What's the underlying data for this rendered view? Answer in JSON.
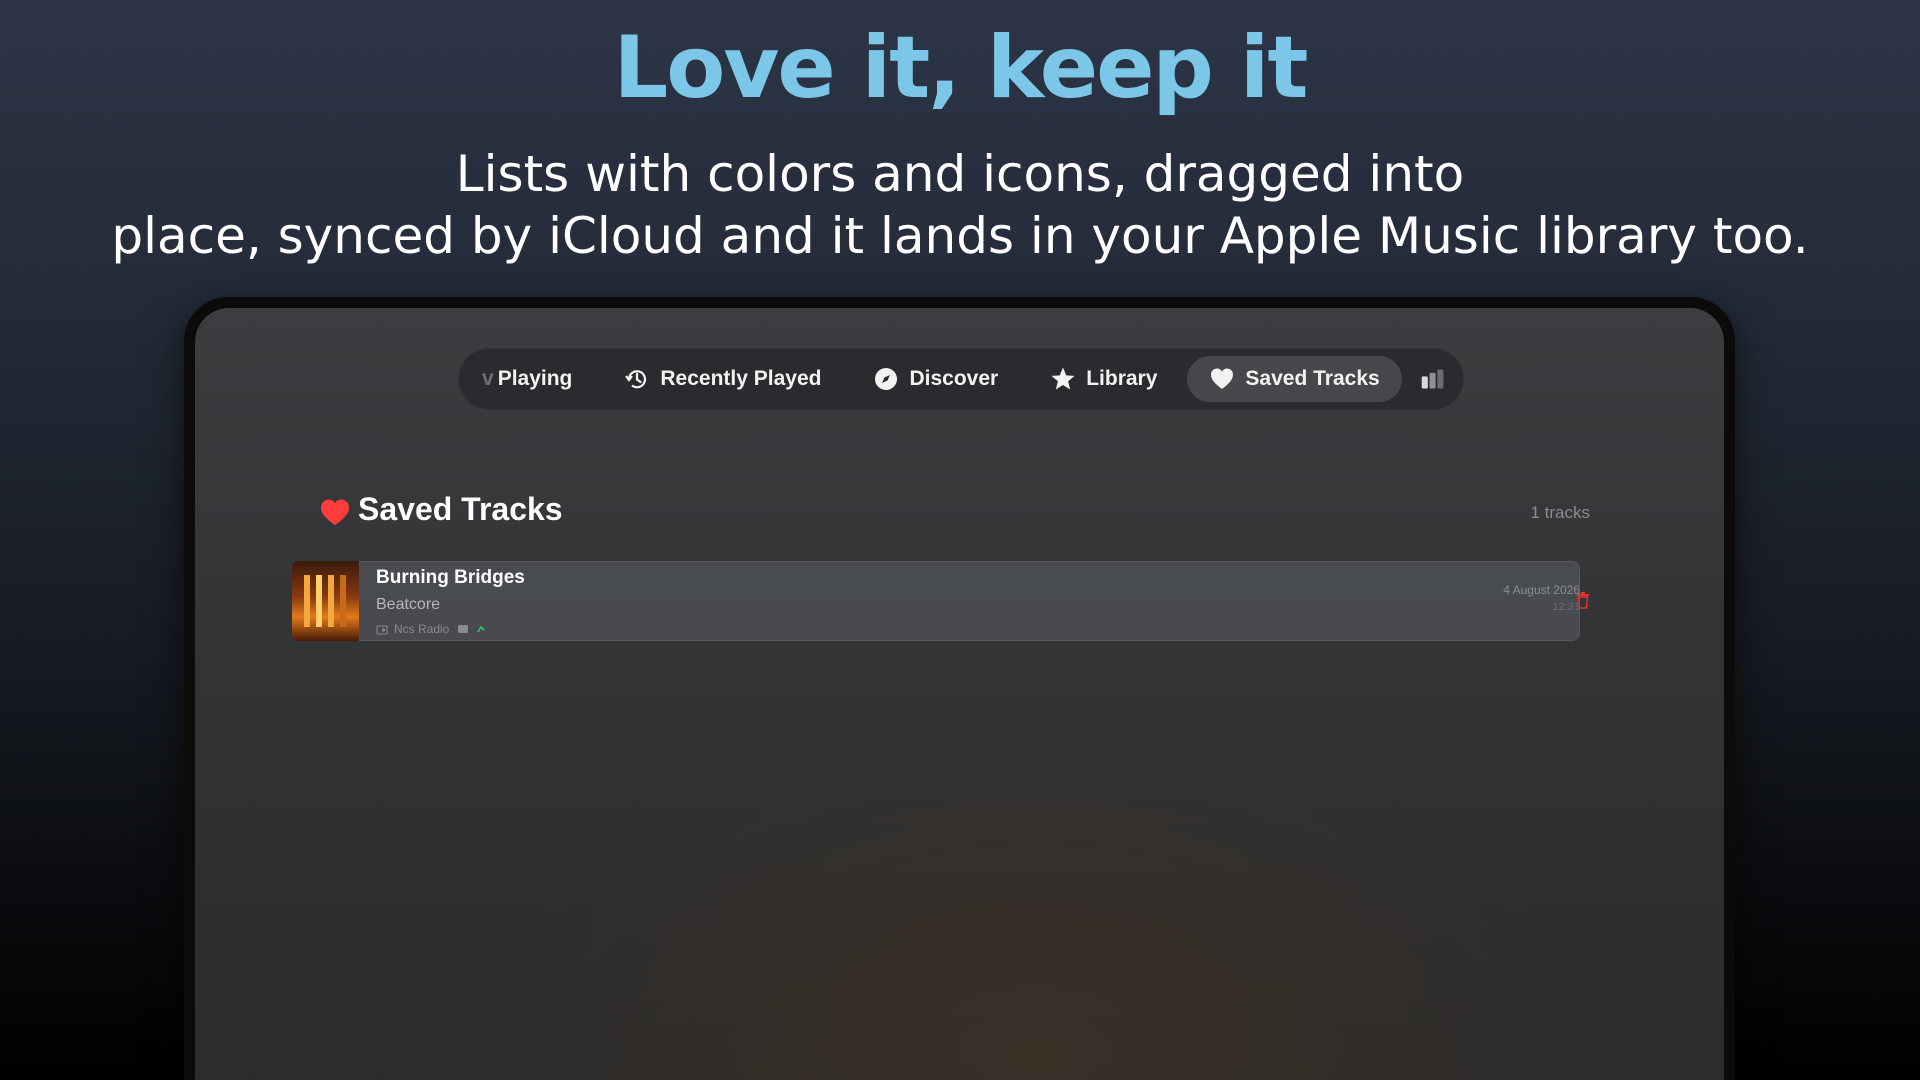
{
  "marketing": {
    "headline": "Love it, keep it",
    "subline_1": "Lists with colors and icons, dragged into",
    "subline_2": "place, synced by iCloud and it lands in your Apple Music library too."
  },
  "tabs": [
    {
      "label": "Playing",
      "icon": "now-playing-icon",
      "active": false
    },
    {
      "label": "Recently Played",
      "icon": "clock-history-icon",
      "active": false
    },
    {
      "label": "Discover",
      "icon": "compass-icon",
      "active": false
    },
    {
      "label": "Library",
      "icon": "star-icon",
      "active": false
    },
    {
      "label": "Saved Tracks",
      "icon": "heart-icon",
      "active": true
    },
    {
      "label": "",
      "icon": "stats-bars-icon",
      "active": false
    }
  ],
  "section": {
    "title": "Saved Tracks",
    "count": "1 tracks",
    "icon": "heart-icon"
  },
  "tracks": [
    {
      "title": "Burning Bridges",
      "artist": "Beatcore",
      "station": "Ncs Radio",
      "date": "4 August 2026",
      "time": "12:31"
    }
  ],
  "colors": {
    "headline": "#7cc6e8",
    "heart": "#ff3b3b",
    "delete": "#e0342c",
    "active_tab": "#46474b"
  }
}
